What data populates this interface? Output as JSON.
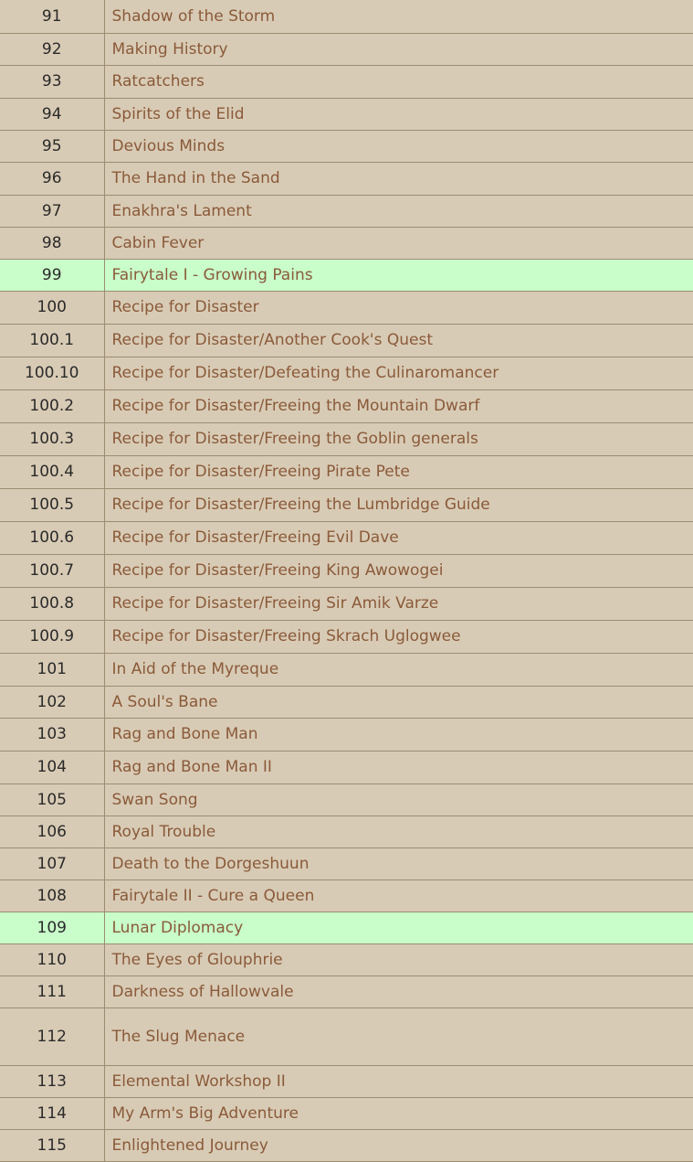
{
  "highlight_color": "#c9fdca",
  "link_color": "#8a5a3a",
  "rows": [
    {
      "num": "91",
      "name": "Shadow of the Storm",
      "h": 36
    },
    {
      "num": "92",
      "name": "Making History",
      "h": 35
    },
    {
      "num": "93",
      "name": "Ratcatchers",
      "h": 36
    },
    {
      "num": "94",
      "name": "Spirits of the Elid",
      "h": 35
    },
    {
      "num": "95",
      "name": "Devious Minds",
      "h": 35
    },
    {
      "num": "96",
      "name": "The Hand in the Sand",
      "h": 36
    },
    {
      "num": "97",
      "name": "Enakhra's Lament",
      "h": 35
    },
    {
      "num": "98",
      "name": "Cabin Fever",
      "h": 35
    },
    {
      "num": "99",
      "name": "Fairytale I - Growing Pains",
      "highlight": true,
      "h": 35
    },
    {
      "num": "100",
      "name": "Recipe for Disaster",
      "h": 36
    },
    {
      "num": "100.1",
      "name": "Recipe for Disaster/Another Cook's Quest",
      "h": 36
    },
    {
      "num": "100.10",
      "name": "Recipe for Disaster/Defeating the Culinaromancer",
      "h": 36
    },
    {
      "num": "100.2",
      "name": "Recipe for Disaster/Freeing the Mountain Dwarf",
      "h": 36
    },
    {
      "num": "100.3",
      "name": "Recipe for Disaster/Freeing the Goblin generals",
      "h": 36
    },
    {
      "num": "100.4",
      "name": "Recipe for Disaster/Freeing Pirate Pete",
      "h": 36
    },
    {
      "num": "100.5",
      "name": "Recipe for Disaster/Freeing the Lumbridge Guide",
      "h": 36
    },
    {
      "num": "100.6",
      "name": "Recipe for Disaster/Freeing Evil Dave",
      "h": 36
    },
    {
      "num": "100.7",
      "name": "Recipe for Disaster/Freeing King Awowogei",
      "h": 36
    },
    {
      "num": "100.8",
      "name": "Recipe for Disaster/Freeing Sir Amik Varze",
      "h": 36
    },
    {
      "num": "100.9",
      "name": "Recipe for Disaster/Freeing Skrach Uglogwee",
      "h": 36
    },
    {
      "num": "101",
      "name": "In Aid of the Myreque",
      "h": 36
    },
    {
      "num": "102",
      "name": "A Soul's Bane",
      "h": 35
    },
    {
      "num": "103",
      "name": "Rag and Bone Man",
      "h": 36
    },
    {
      "num": "104",
      "name": "Rag and Bone Man II",
      "h": 36
    },
    {
      "num": "105",
      "name": "Swan Song",
      "h": 35
    },
    {
      "num": "106",
      "name": "Royal Trouble",
      "h": 35
    },
    {
      "num": "107",
      "name": "Death to the Dorgeshuun",
      "h": 35
    },
    {
      "num": "108",
      "name": "Fairytale II - Cure a Queen",
      "h": 35
    },
    {
      "num": "109",
      "name": "Lunar Diplomacy",
      "highlight": true,
      "h": 35
    },
    {
      "num": "110",
      "name": "The Eyes of Glouphrie",
      "h": 35
    },
    {
      "num": "111",
      "name": "Darkness of Hallowvale",
      "h": 35
    },
    {
      "num": "112",
      "name": "The Slug Menace",
      "h": 63
    },
    {
      "num": "113",
      "name": "Elemental Workshop II",
      "h": 35
    },
    {
      "num": "114",
      "name": "My Arm's Big Adventure",
      "h": 35
    },
    {
      "num": "115",
      "name": "Enlightened Journey",
      "h": 35
    }
  ]
}
